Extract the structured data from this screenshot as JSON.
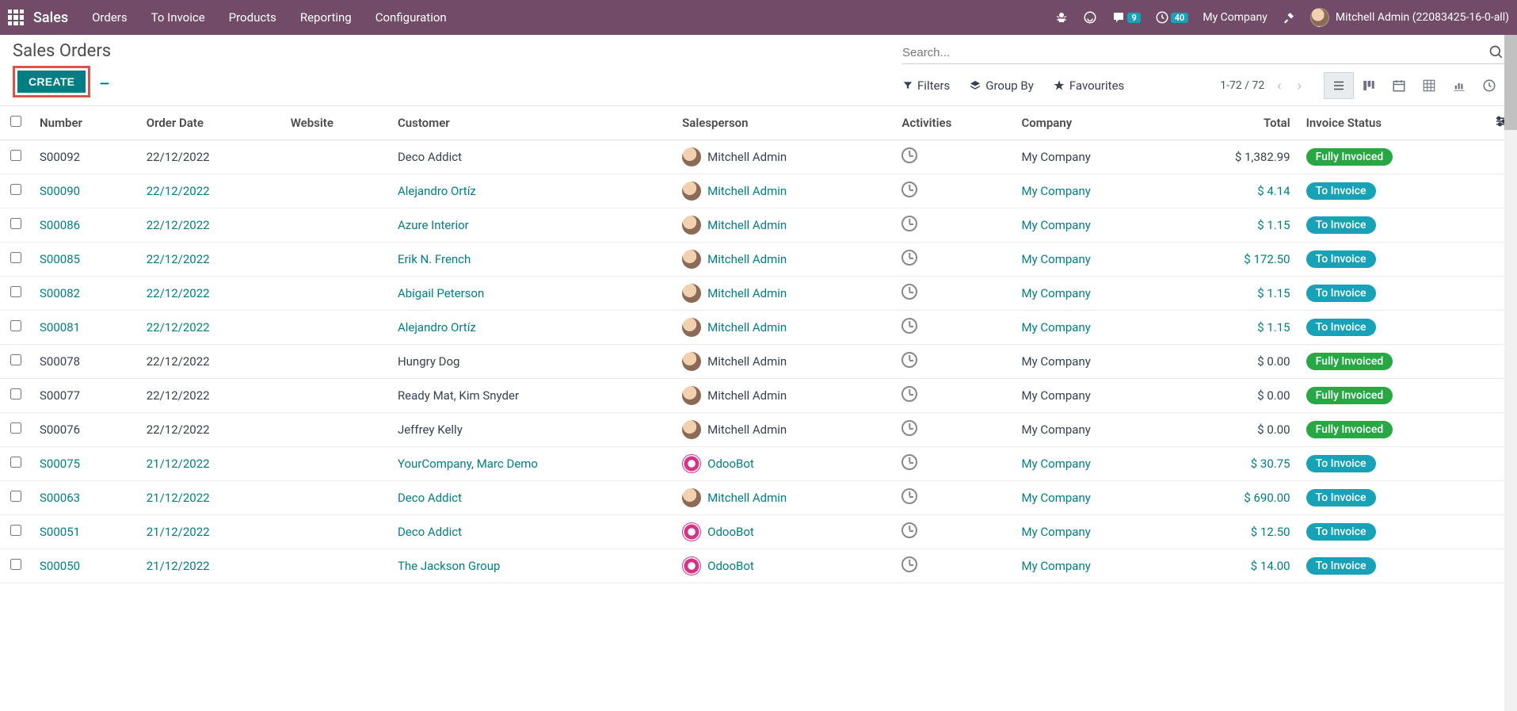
{
  "topnav": {
    "brand": "Sales",
    "links": [
      "Orders",
      "To Invoice",
      "Products",
      "Reporting",
      "Configuration"
    ],
    "chat_badge": "9",
    "activity_badge": "40",
    "company": "My Company",
    "user": "Mitchell Admin (22083425-16-0-all)"
  },
  "header": {
    "title": "Sales Orders",
    "create_label": "CREATE"
  },
  "search": {
    "placeholder": "Search..."
  },
  "toolbar": {
    "filters": "Filters",
    "groupby": "Group By",
    "favourites": "Favourites",
    "pager": "1-72 / 72"
  },
  "columns": {
    "number": "Number",
    "order_date": "Order Date",
    "website": "Website",
    "customer": "Customer",
    "salesperson": "Salesperson",
    "activities": "Activities",
    "company": "Company",
    "total": "Total",
    "invoice_status": "Invoice Status"
  },
  "status_labels": {
    "invoiced": "Fully Invoiced",
    "toinvoice": "To Invoice"
  },
  "rows": [
    {
      "number": "S00092",
      "date": "22/12/2022",
      "customer": "Deco Addict",
      "sp": "Mitchell Admin",
      "sp_bot": false,
      "company": "My Company",
      "total": "$ 1,382.99",
      "status": "invoiced",
      "link": false
    },
    {
      "number": "S00090",
      "date": "22/12/2022",
      "customer": "Alejandro Ortíz",
      "sp": "Mitchell Admin",
      "sp_bot": false,
      "company": "My Company",
      "total": "$ 4.14",
      "status": "toinvoice",
      "link": true
    },
    {
      "number": "S00086",
      "date": "22/12/2022",
      "customer": "Azure Interior",
      "sp": "Mitchell Admin",
      "sp_bot": false,
      "company": "My Company",
      "total": "$ 1.15",
      "status": "toinvoice",
      "link": true
    },
    {
      "number": "S00085",
      "date": "22/12/2022",
      "customer": "Erik N. French",
      "sp": "Mitchell Admin",
      "sp_bot": false,
      "company": "My Company",
      "total": "$ 172.50",
      "status": "toinvoice",
      "link": true
    },
    {
      "number": "S00082",
      "date": "22/12/2022",
      "customer": "Abigail Peterson",
      "sp": "Mitchell Admin",
      "sp_bot": false,
      "company": "My Company",
      "total": "$ 1.15",
      "status": "toinvoice",
      "link": true
    },
    {
      "number": "S00081",
      "date": "22/12/2022",
      "customer": "Alejandro Ortíz",
      "sp": "Mitchell Admin",
      "sp_bot": false,
      "company": "My Company",
      "total": "$ 1.15",
      "status": "toinvoice",
      "link": true
    },
    {
      "number": "S00078",
      "date": "22/12/2022",
      "customer": "Hungry Dog",
      "sp": "Mitchell Admin",
      "sp_bot": false,
      "company": "My Company",
      "total": "$ 0.00",
      "status": "invoiced",
      "link": false
    },
    {
      "number": "S00077",
      "date": "22/12/2022",
      "customer": "Ready Mat, Kim Snyder",
      "sp": "Mitchell Admin",
      "sp_bot": false,
      "company": "My Company",
      "total": "$ 0.00",
      "status": "invoiced",
      "link": false
    },
    {
      "number": "S00076",
      "date": "22/12/2022",
      "customer": "Jeffrey Kelly",
      "sp": "Mitchell Admin",
      "sp_bot": false,
      "company": "My Company",
      "total": "$ 0.00",
      "status": "invoiced",
      "link": false
    },
    {
      "number": "S00075",
      "date": "21/12/2022",
      "customer": "YourCompany, Marc Demo",
      "sp": "OdooBot",
      "sp_bot": true,
      "company": "My Company",
      "total": "$ 30.75",
      "status": "toinvoice",
      "link": true
    },
    {
      "number": "S00063",
      "date": "21/12/2022",
      "customer": "Deco Addict",
      "sp": "Mitchell Admin",
      "sp_bot": false,
      "company": "My Company",
      "total": "$ 690.00",
      "status": "toinvoice",
      "link": true
    },
    {
      "number": "S00051",
      "date": "21/12/2022",
      "customer": "Deco Addict",
      "sp": "OdooBot",
      "sp_bot": true,
      "company": "My Company",
      "total": "$ 12.50",
      "status": "toinvoice",
      "link": true
    },
    {
      "number": "S00050",
      "date": "21/12/2022",
      "customer": "The Jackson Group",
      "sp": "OdooBot",
      "sp_bot": true,
      "company": "My Company",
      "total": "$ 14.00",
      "status": "toinvoice",
      "link": true
    }
  ]
}
